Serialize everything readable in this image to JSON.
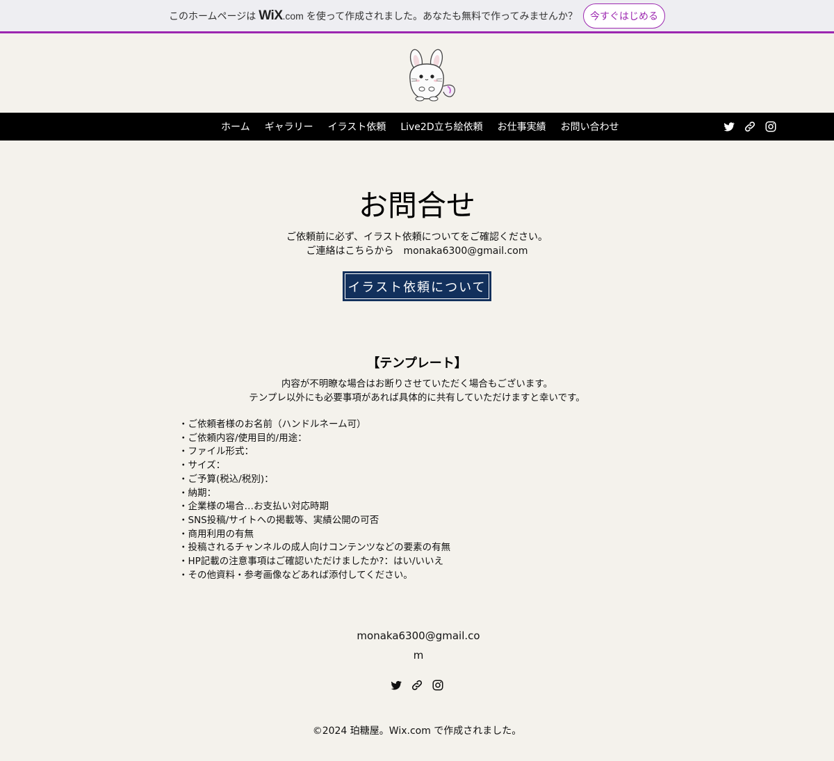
{
  "banner": {
    "text_before": "このホームページは",
    "brand_wix": "WiX",
    "brand_com": ".com",
    "text_after": "を使って作成されました。あなたも無料で作ってみませんか？",
    "cta": "今すぐはじめる",
    "accent_color": "#9c27b0"
  },
  "header": {
    "logo_icon": "chinchilla-mascot-icon"
  },
  "nav": {
    "items": [
      "ホーム",
      "ギャラリー",
      "イラスト依頼",
      "Live2D立ち絵依頼",
      "お仕事実績",
      "お問い合わせ"
    ],
    "social_icons": [
      "twitter-icon",
      "link-icon",
      "instagram-icon"
    ]
  },
  "main": {
    "title": "お問合せ",
    "intro_line1": "ご依頼前に必ず、イラスト依頼についてをご確認ください。",
    "intro_line2": "ご連絡はこちらから　monaka6300@gmail.com",
    "cta_button": "イラスト依頼について",
    "cta_color": "#12305c"
  },
  "template": {
    "heading": "【テンプレート】",
    "note1": "内容が不明瞭な場合はお断りさせていただく場合もございます。",
    "note2": "テンプレ以外にも必要事項があれば具体的に共有していただけますと幸いです。",
    "items": [
      "・ご依頼者様のお名前（ハンドルネーム可）",
      "・ご依頼内容/使用目的/用途：",
      "・ファイル形式：",
      "・サイズ：",
      "・ご予算(税込/税別)：",
      "・納期：",
      "・企業様の場合…お支払い対応時期",
      "・SNS投稿/サイトへの掲載等、実績公開の可否",
      "・商用利用の有無",
      "・投稿されるチャンネルの成人向けコンテンツなどの要素の有無",
      "・HP記載の注意事項はご確認いただけましたか?：はい/いいえ",
      "・その他資料・参考画像などあれば添付してください。"
    ]
  },
  "footer": {
    "email": "monaka6300@gmail.com",
    "social_icons": [
      "twitter-icon",
      "link-icon",
      "instagram-icon"
    ],
    "copyright": "©2024 珀糖屋。Wix.com で作成されました。"
  }
}
